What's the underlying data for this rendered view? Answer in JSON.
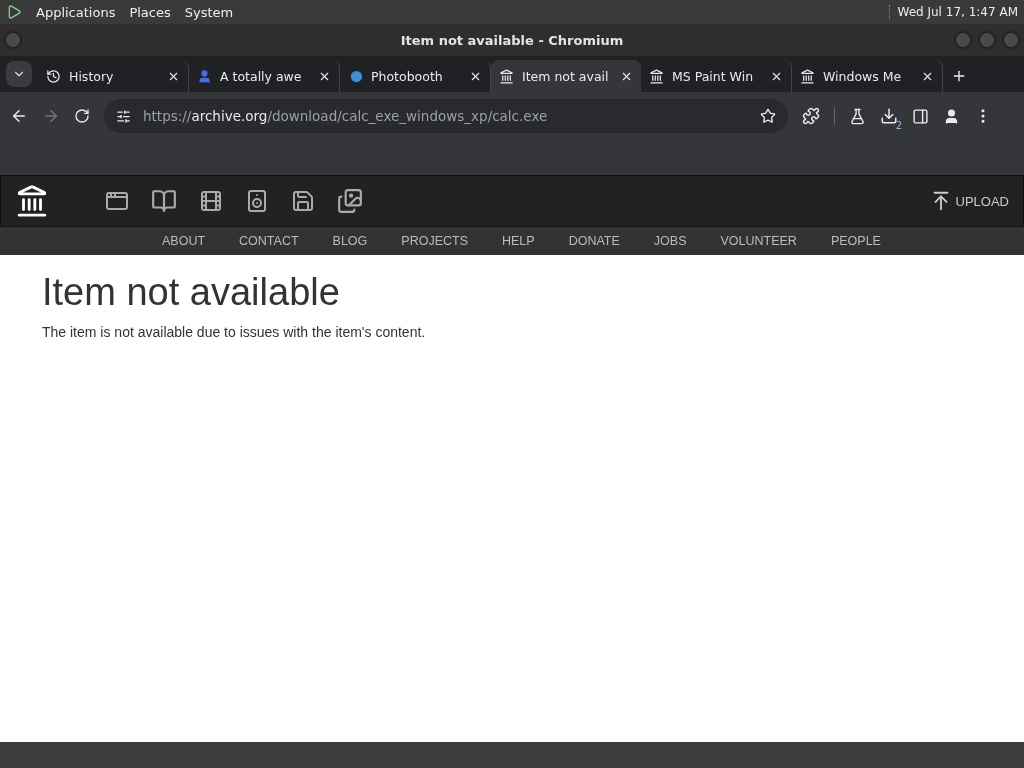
{
  "top_panel": {
    "menus": [
      "Applications",
      "Places",
      "System"
    ],
    "clock": "Wed Jul 17, 1:47 AM"
  },
  "window": {
    "title": "Item not available - Chromium"
  },
  "tabs": [
    {
      "title": "History",
      "kind": "history",
      "selected": false
    },
    {
      "title": "A totally awe",
      "kind": "figure",
      "selected": false
    },
    {
      "title": "Photobooth",
      "kind": "orb",
      "selected": false
    },
    {
      "title": "Item not avail",
      "kind": "archive",
      "selected": true
    },
    {
      "title": "MS Paint Win",
      "kind": "archive",
      "selected": false
    },
    {
      "title": "Windows Me",
      "kind": "archive",
      "selected": false
    }
  ],
  "toolbar": {
    "url_scheme": "https://",
    "url_host": "archive.org",
    "url_path": "/download/calc_exe_windows_xp/calc.exe",
    "downloads_badge": "2"
  },
  "site": {
    "upload": "UPLOAD",
    "nav": [
      "ABOUT",
      "CONTACT",
      "BLOG",
      "PROJECTS",
      "HELP",
      "DONATE",
      "JOBS",
      "VOLUNTEER",
      "PEOPLE"
    ]
  },
  "content": {
    "heading": "Item not available",
    "message": "The item is not available due to issues with the item's content."
  }
}
